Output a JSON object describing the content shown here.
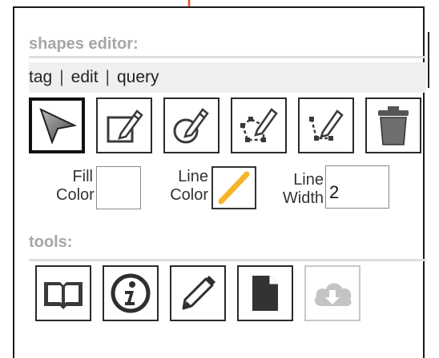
{
  "shapes_editor": {
    "title": "shapes editor:",
    "tabs": [
      {
        "label": "tag"
      },
      {
        "label": "edit"
      },
      {
        "label": "query"
      }
    ],
    "separator": "|",
    "tools": [
      {
        "icon": "pointer-arrow-icon",
        "active": true
      },
      {
        "icon": "rectangle-pencil-icon"
      },
      {
        "icon": "circle-pencil-icon"
      },
      {
        "icon": "polygon-pencil-icon"
      },
      {
        "icon": "polyline-pencil-icon"
      },
      {
        "icon": "trash-icon"
      }
    ],
    "fill_color": {
      "label_line1": "Fill",
      "label_line2": "Color",
      "value": "#ffffff"
    },
    "line_color": {
      "label_line1": "Line",
      "label_line2": "Color",
      "value": "#f5b42a"
    },
    "line_width": {
      "label_line1": "Line",
      "label_line2": "Width",
      "value": "2"
    }
  },
  "tools_section": {
    "title": "tools:",
    "buttons": [
      {
        "icon": "book-icon"
      },
      {
        "icon": "info-icon"
      },
      {
        "icon": "pencil-icon"
      },
      {
        "icon": "document-icon"
      },
      {
        "icon": "cloud-download-icon",
        "disabled": true
      }
    ]
  },
  "colors": {
    "accent_arrow": "#ee4b1f",
    "section_title": "#a6a6a6",
    "icon_fill": "#3a3a3a"
  }
}
